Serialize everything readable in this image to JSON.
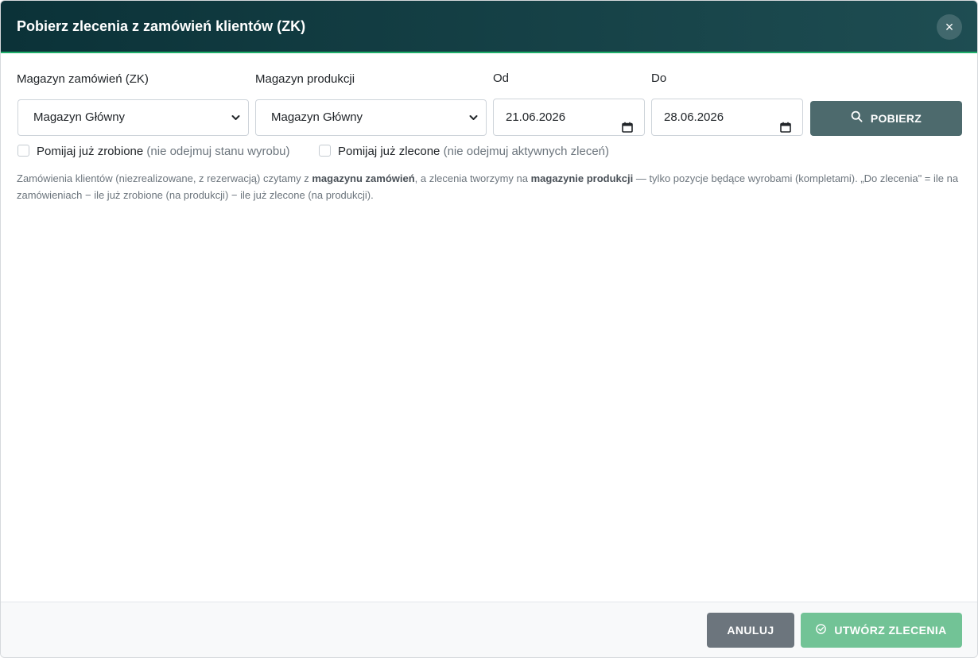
{
  "modal": {
    "title": "Pobierz zlecenia z zamówień klientów (ZK)",
    "close_label": "×"
  },
  "filters": {
    "order_warehouse_label": "Magazyn zamówień (ZK)",
    "order_warehouse_value": "Magazyn Główny",
    "production_warehouse_label": "Magazyn produkcji",
    "production_warehouse_value": "Magazyn Główny",
    "from_label": "Od",
    "from_value": "21.06.2026",
    "to_label": "Do",
    "to_value": "28.06.2026",
    "fetch_label": "POBIERZ"
  },
  "options": {
    "skip_done_label": "Pomijaj już zrobione",
    "skip_done_hint": "(nie odejmuj stanu wyrobu)",
    "skip_done_checked": false,
    "skip_ordered_label": "Pomijaj już zlecone",
    "skip_ordered_hint": "(nie odejmuj aktywnych zleceń)",
    "skip_ordered_checked": false
  },
  "info": {
    "part1": "Zamówienia klientów (niezrealizowane, z rezerwacją) czytamy z ",
    "bold1": "magazynu zamówień",
    "part2": ", a zlecenia tworzymy na ",
    "bold2": "magazynie produkcji",
    "part3": " — tylko pozycje będące wyrobami (kompletami). „Do zlecenia\" = ile na zamówieniach − ile już zrobione (na produkcji) − ile już zlecone (na produkcji)."
  },
  "footer": {
    "cancel_label": "ANULUJ",
    "create_label": "UTWÓRZ ZLECENIA"
  },
  "icons": {
    "close": "close-icon",
    "fetch": "search-icon",
    "create": "check-circle-icon",
    "calendar": "calendar-icon",
    "select": "chevron-down-icon"
  },
  "colors": {
    "header_start": "#0b3238",
    "header_end": "#1e4d52",
    "header_accent": "#1fae6a",
    "fetch_button": "#4d6a6d",
    "cancel_button": "#6c757d",
    "create_button": "#72c396"
  }
}
